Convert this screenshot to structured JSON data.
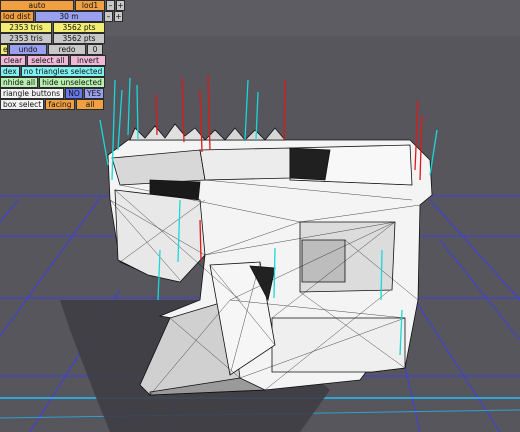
{
  "panel": {
    "mode": "auto",
    "lod": "lod1",
    "lod_minus": "–",
    "lod_plus": "+",
    "lod_dist_label": "lod dist",
    "lod_dist_value": "30 m",
    "lod_dist_minus": "–",
    "lod_dist_plus": "+",
    "tris_1": "2353 tris",
    "pts_1": "3562 pts",
    "tris_2": "2353 tris",
    "pts_2": "3562 pts",
    "mode_row_label": "e",
    "undo": "undo",
    "redo": "redo",
    "count": "0",
    "clear": "clear",
    "select_all": "select all",
    "invert": "invert",
    "index_label": "dex",
    "index_value": "no triangles selected",
    "unhide_all": "nhide all",
    "hide_unselected": "hide unselected",
    "triangle_buttons_label": "riangle buttons :",
    "no": "NO",
    "yes": "YES",
    "box_select_label": "box select :",
    "facing": "facing",
    "all": "all"
  },
  "colors": {
    "background": "#5a5a60",
    "floor": "#5a5a62",
    "grid": "#3030ff",
    "grid_highlight": "#20e0ff",
    "normal_red": "#e01010",
    "normal_cyan": "#10e0e0"
  }
}
